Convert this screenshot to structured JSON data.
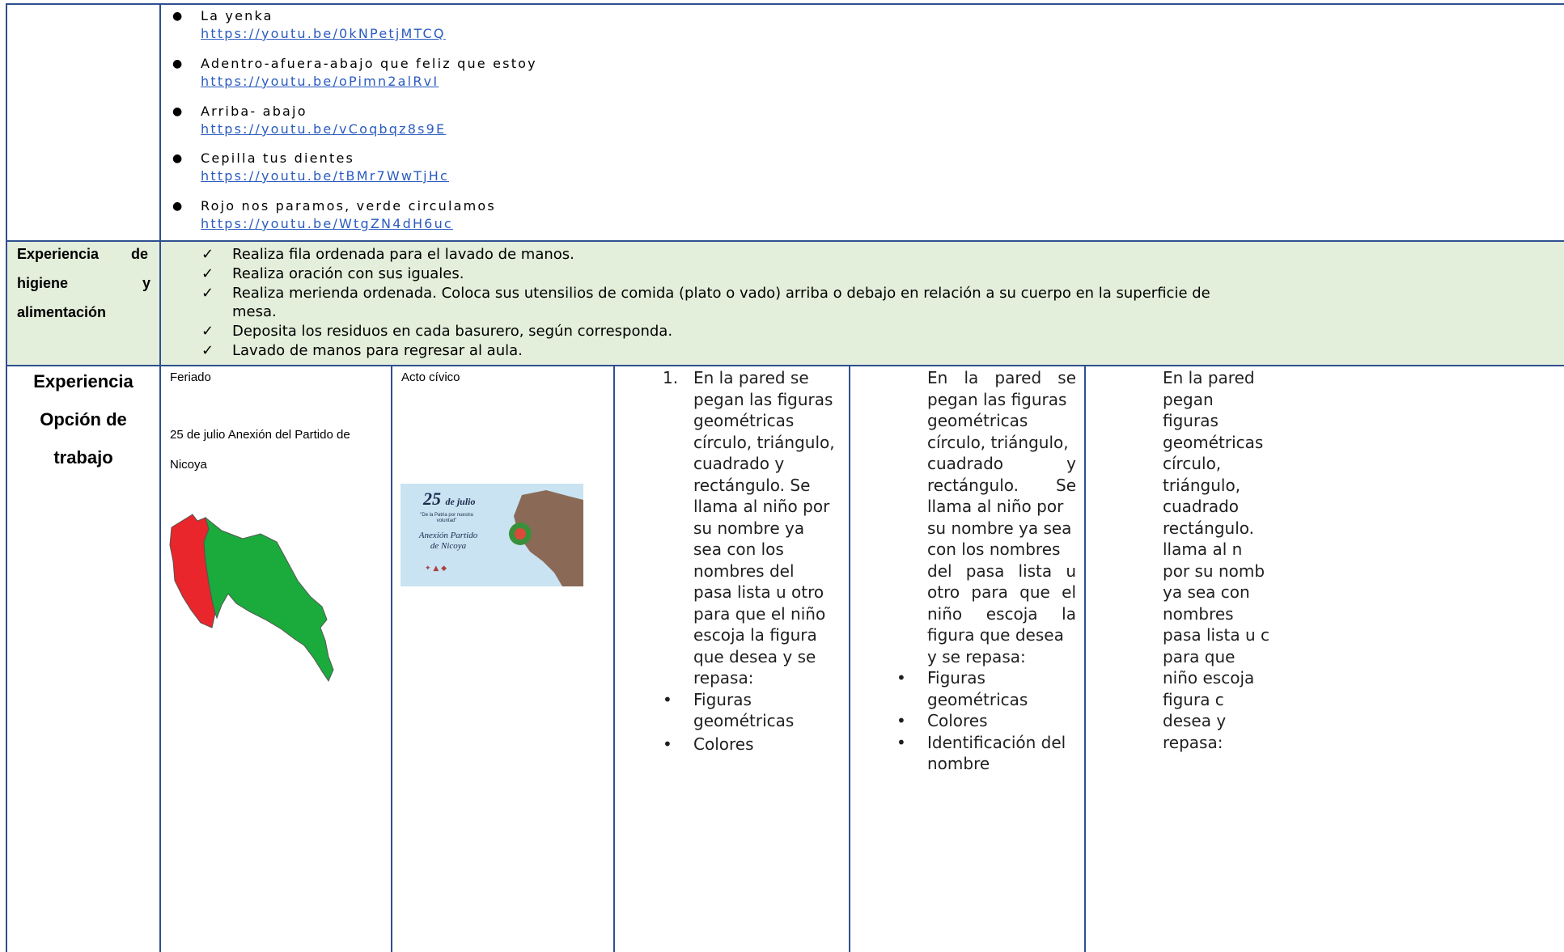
{
  "songs": [
    {
      "title": "La yenka",
      "link": "https://youtu.be/0kNPetjMTCQ"
    },
    {
      "title": "Adentro-afuera-abajo que feliz que estoy",
      "link": "https://youtu.be/oPimn2alRvI"
    },
    {
      "title": "Arriba- abajo",
      "link": "https://youtu.be/vCoqbqz8s9E"
    },
    {
      "title": "Cepilla tus dientes",
      "link": "https://youtu.be/tBMr7WwTjHc"
    },
    {
      "title": "Rojo nos paramos, verde circulamos",
      "link": "https://youtu.be/WtgZN4dH6uc"
    }
  ],
  "hygiene": {
    "label_line1_a": "Experiencia",
    "label_line1_b": "de",
    "label_line2_a": "higiene",
    "label_line2_b": "y",
    "label_line3": "alimentación",
    "checkmark": "✓",
    "items": [
      "Realiza fila ordenada para el lavado de manos.",
      "Realiza oración con sus iguales.",
      "Realiza merienda ordenada. Coloca sus utensilios de comida (plato o vado) arriba o debajo en relación a su cuerpo en la superficie de",
      "mesa.",
      "Deposita los residuos en cada basurero, según corresponda.",
      "Lavado de manos para regresar al aula."
    ]
  },
  "experience": {
    "label_1": "Experiencia",
    "label_2": "Opción de",
    "label_3": "trabajo",
    "col1": {
      "title": "Feriado",
      "line1": "25 de julio Anexión del Partido de",
      "line2": "Nicoya"
    },
    "col2": {
      "title": "Acto cívico",
      "poster_date": "25",
      "poster_month": "de julio",
      "poster_quote": "\"De la Patria por nuestra voluntad\"",
      "poster_title_1": "Anexión Partido",
      "poster_title_2": "de Nicoya"
    },
    "col3": {
      "num": "1.",
      "lines": [
        "En la pared se",
        "pegan las figuras",
        "geométricas",
        "círculo, triángulo,",
        "cuadrado y",
        "rectángulo. Se",
        "llama al niño por",
        "su nombre ya",
        "sea con los",
        "nombres del",
        "pasa lista u otro",
        "para que el niño",
        "escoja la figura",
        "que desea y se",
        "repasa:"
      ],
      "bullets": [
        [
          "Figuras",
          "geométricas"
        ],
        [
          "Colores"
        ]
      ]
    },
    "col4": {
      "lines": [
        "En la pared se",
        "pegan las figuras",
        "geométricas",
        "círculo, triángulo,",
        "cuadrado y",
        "rectángulo. Se",
        "llama al niño por",
        "su nombre ya sea",
        "con los nombres",
        "del pasa lista u",
        "otro para que el",
        "niño escoja la",
        "figura que desea",
        "y se repasa:"
      ],
      "bullets": [
        [
          "Figuras",
          "geométricas"
        ],
        [
          "Colores"
        ],
        [
          "Identificación del",
          "nombre"
        ]
      ]
    },
    "col5": {
      "lines": [
        "En la pared",
        "pegan",
        "figuras",
        "geométricas",
        "círculo,",
        "triángulo,",
        "cuadrado",
        "rectángulo.",
        "llama al n",
        "por su nomb",
        "ya sea con",
        "nombres",
        "pasa lista u c",
        "para que",
        "niño escoja",
        "figura c",
        "desea y",
        "repasa:"
      ]
    }
  },
  "colors": {
    "border": "#2f4f8f",
    "hygiene_bg": "#e3eedb",
    "link": "#2a5bbf",
    "map_red": "#e8262b",
    "map_green": "#1aab3c",
    "poster_bg": "#c9e3f3"
  }
}
